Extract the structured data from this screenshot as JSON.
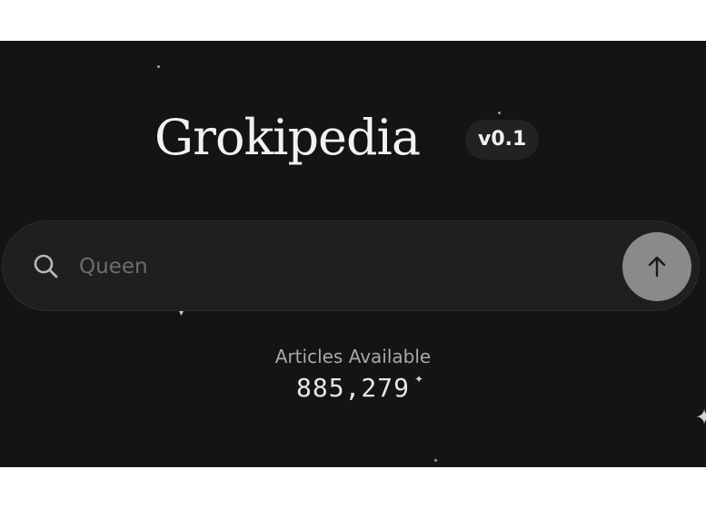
{
  "brand": {
    "title": "Grokipedia",
    "version": "v0.1"
  },
  "search": {
    "placeholder": "Queen",
    "icon": "search-icon",
    "submit_icon": "arrow-up-icon"
  },
  "stats": {
    "label": "Articles Available",
    "value": "885,279"
  },
  "colors": {
    "background": "#141414",
    "search_bg": "#1f1f1f",
    "submit_bg": "#8a8a8a",
    "text": "#f2f2f2",
    "muted": "#a8a8a8"
  }
}
